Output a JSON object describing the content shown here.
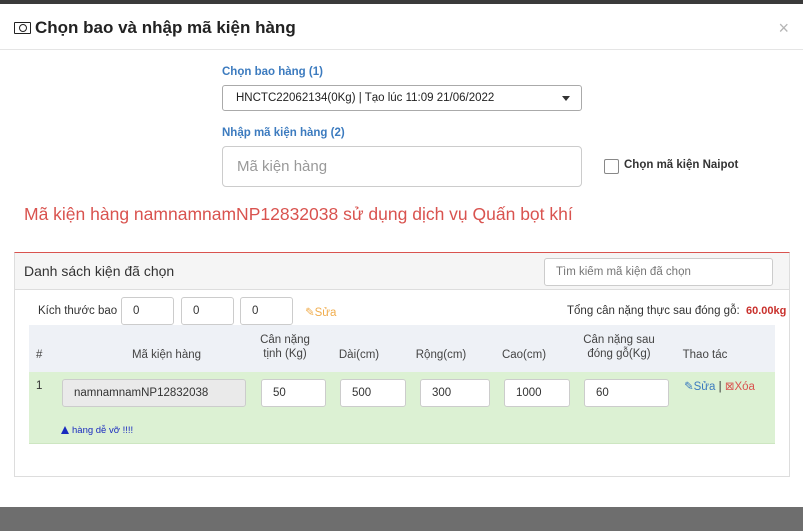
{
  "dialog": {
    "title": "Chọn bao và nhập mã kiện hàng",
    "close_label": "×"
  },
  "form": {
    "bag_label": "Chọn bao hàng (1)",
    "bag_selected": "HNCTC22062134(0Kg) | Tạo lúc 11:09 21/06/2022",
    "code_label": "Nhập mã kiện hàng (2)",
    "code_placeholder": "Mã kiện hàng",
    "naipot_label": "Chọn mã kiện Naipot"
  },
  "notice": "Mã kiện hàng namnamnamNP12832038 sử dụng dịch vụ Quấn bọt khí",
  "panel": {
    "title": "Danh sách kiện đã chọn",
    "search_placeholder": "Tìm kiếm mã kiện đã chọn",
    "size_label": "Kích thước bao",
    "size_values": [
      "0",
      "0",
      "0"
    ],
    "edit_label": "Sửa",
    "total_label": "Tổng cân nặng thực sau đóng gỗ:",
    "total_value": "60.00kg"
  },
  "table": {
    "headers": {
      "num": "#",
      "code": "Mã kiện hàng",
      "net_weight": "Cân nặng tịnh (Kg)",
      "length": "Dài(cm)",
      "width": "Rộng(cm)",
      "height": "Cao(cm)",
      "packed_weight": "Cân nặng sau đóng gỗ(Kg)",
      "actions": "Thao tác"
    },
    "rows": [
      {
        "num": "1",
        "code": "namnamnamNP12832038",
        "net_weight": "50",
        "length": "500",
        "width": "300",
        "height": "1000",
        "packed_weight": "60",
        "edit": "Sửa",
        "separator": "|",
        "delete": "Xóa",
        "warning": "hàng dễ vỡ !!!!"
      }
    ]
  },
  "colors": {
    "label_blue": "#3c7bbf",
    "notice_red": "#d9534f",
    "row_green": "#dcf1d3",
    "edit_orange": "#f0ad4e"
  }
}
